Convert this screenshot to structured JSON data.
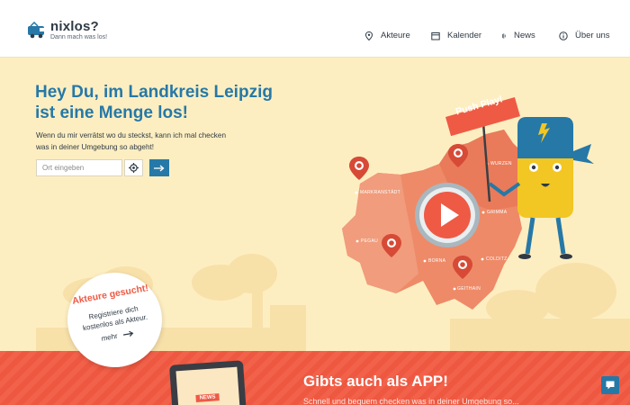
{
  "header": {
    "logo": {
      "name": "nixlos?",
      "tagline": "Dann mach was los!"
    },
    "nav": [
      {
        "label": "Akteure",
        "icon": "location-pin-icon"
      },
      {
        "label": "Kalender",
        "icon": "calendar-icon"
      },
      {
        "label": "News",
        "icon": "news-icon"
      },
      {
        "label": "Über uns",
        "icon": "info-icon"
      }
    ]
  },
  "hero": {
    "title_line1": "Hey Du, im Landkreis Leipzig",
    "title_line2": "ist eine Menge los!",
    "text_line1": "Wenn du mir verrätst wo du steckst, kann ich mal checken",
    "text_line2": "was in deiner Umgebung so abgeht!",
    "search_placeholder": "Ort eingeben"
  },
  "map": {
    "labels": [
      "MARKRANSTÄDT",
      "WURZEN",
      "GRIMMA",
      "PEGAU",
      "BORNA",
      "COLDITZ",
      "GEITHAIN"
    ],
    "sign": "Push Play!"
  },
  "akteure_badge": {
    "title": "Akteure gesucht!",
    "text_line1": "Registriere dich",
    "text_line2": "kostenlos als Akteur.",
    "more": "mehr"
  },
  "app": {
    "title": "Gibts auch als APP!",
    "subtitle": "Schnell und bequem checken was in deiner Umgebung so...",
    "tablet_label": "NEWS"
  },
  "colors": {
    "primary": "#2678a7",
    "accent": "#ef5a45",
    "background": "#fdeec1",
    "map": "#ee8a68"
  }
}
